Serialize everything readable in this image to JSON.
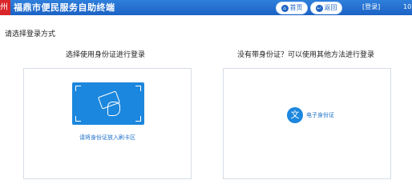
{
  "header": {
    "logo_char": "州",
    "title": "福鼎市便民服务自助终端",
    "home_label": "首页",
    "home_icon": "home-icon",
    "back_label": "返回",
    "back_icon": "back-icon",
    "login_label": "[登录]",
    "corner_text": "10"
  },
  "main": {
    "section_label": "请选择登录方式",
    "left_title": "选择使用身份证进行登录",
    "right_title": "没有带身份证？可以使用其他方法进行登录",
    "insert_label": "请将身份证放入刷卡区",
    "ecard_icon_char": "文",
    "ecard_label": "电子身份证"
  },
  "colors": {
    "header_blue": "#1b62c4",
    "accent_blue": "#1c87de",
    "logo_red": "#d9262b"
  }
}
